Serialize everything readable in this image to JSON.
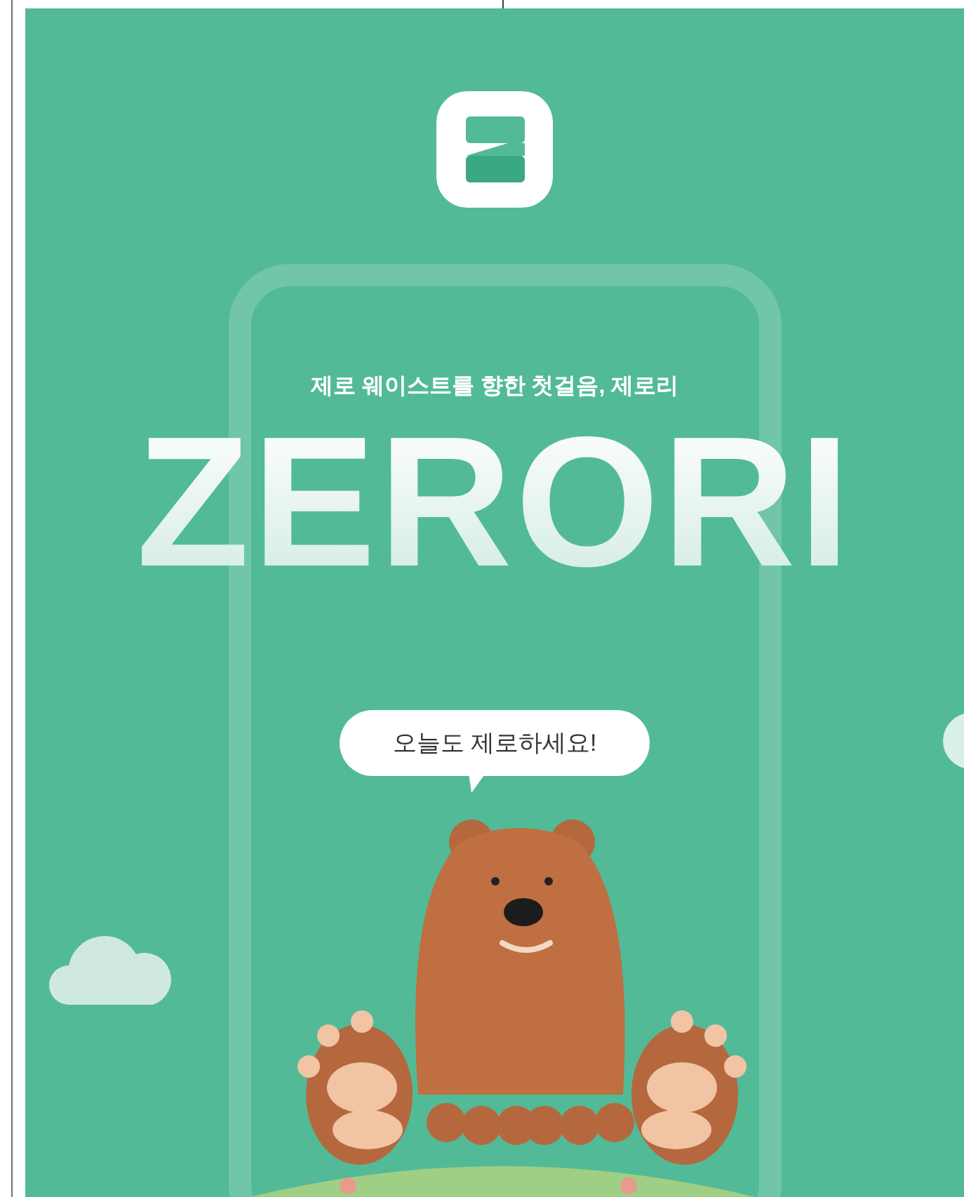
{
  "tagline": "제로 웨이스트를 향한 첫걸음, 제로리",
  "title": "ZERORI",
  "speech_bubble": "오늘도 제로하세요!"
}
